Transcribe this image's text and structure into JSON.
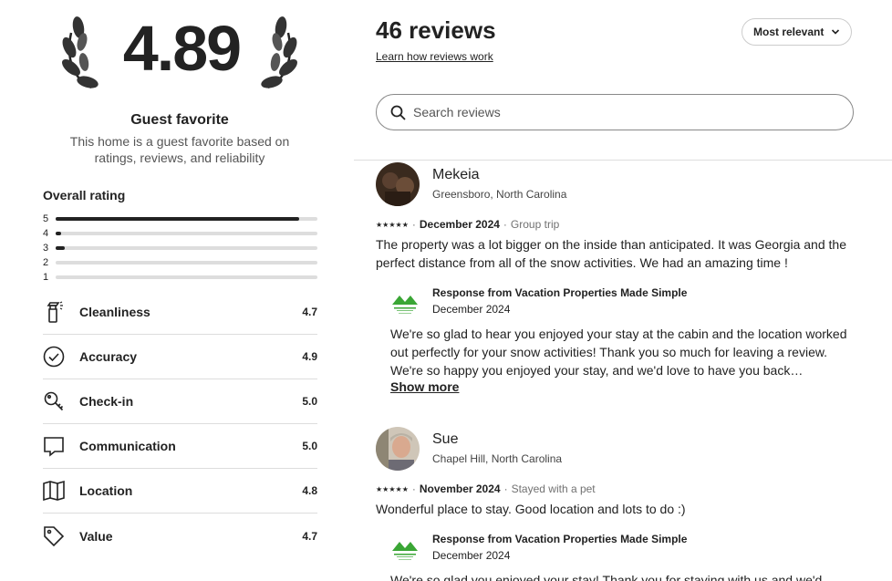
{
  "summary": {
    "rating": "4.89",
    "title": "Guest favorite",
    "subtitle": "This home is a guest favorite based on ratings, reviews, and reliability"
  },
  "overall": {
    "title": "Overall rating",
    "bars": [
      {
        "label": "5",
        "fraction": 0.93
      },
      {
        "label": "4",
        "fraction": 0.02
      },
      {
        "label": "3",
        "fraction": 0.035
      },
      {
        "label": "2",
        "fraction": 0
      },
      {
        "label": "1",
        "fraction": 0
      }
    ]
  },
  "categories": [
    {
      "label": "Cleanliness",
      "value": "4.7",
      "icon": "spray-bottle-icon"
    },
    {
      "label": "Accuracy",
      "value": "4.9",
      "icon": "check-circle-icon"
    },
    {
      "label": "Check-in",
      "value": "5.0",
      "icon": "key-icon"
    },
    {
      "label": "Communication",
      "value": "5.0",
      "icon": "chat-bubble-icon"
    },
    {
      "label": "Location",
      "value": "4.8",
      "icon": "map-icon"
    },
    {
      "label": "Value",
      "value": "4.7",
      "icon": "tag-icon"
    }
  ],
  "header": {
    "count": "46 reviews",
    "learn": "Learn how reviews work",
    "sort": "Most relevant"
  },
  "search": {
    "placeholder": "Search reviews"
  },
  "reviews": [
    {
      "name": "Mekeia",
      "location": "Greensboro, North Carolina",
      "stars": "★★★★★",
      "date": "December 2024",
      "trip": "Group trip",
      "text": "The property was a lot bigger on the inside than anticipated. It was Georgia and the perfect distance from all of the snow activities. We had an amazing time !",
      "response": {
        "title": "Response from Vacation Properties Made Simple",
        "date": "December 2024",
        "text": "We're so glad to hear you enjoyed your stay at the cabin and the location worked out perfectly for your snow activities! Thank you so much for leaving a review. We're so happy you enjoyed your stay, and we'd love to have you back…",
        "more": "Show more"
      }
    },
    {
      "name": "Sue",
      "location": "Chapel Hill, North Carolina",
      "stars": "★★★★★",
      "date": "November 2024",
      "trip": "Stayed with a pet",
      "text": "Wonderful place to stay.  Good location and lots to do :)",
      "response": {
        "title": "Response from Vacation Properties Made Simple",
        "date": "December 2024",
        "text": "We're so glad you enjoyed your stay! Thank you for staying with us and we'd"
      }
    }
  ]
}
